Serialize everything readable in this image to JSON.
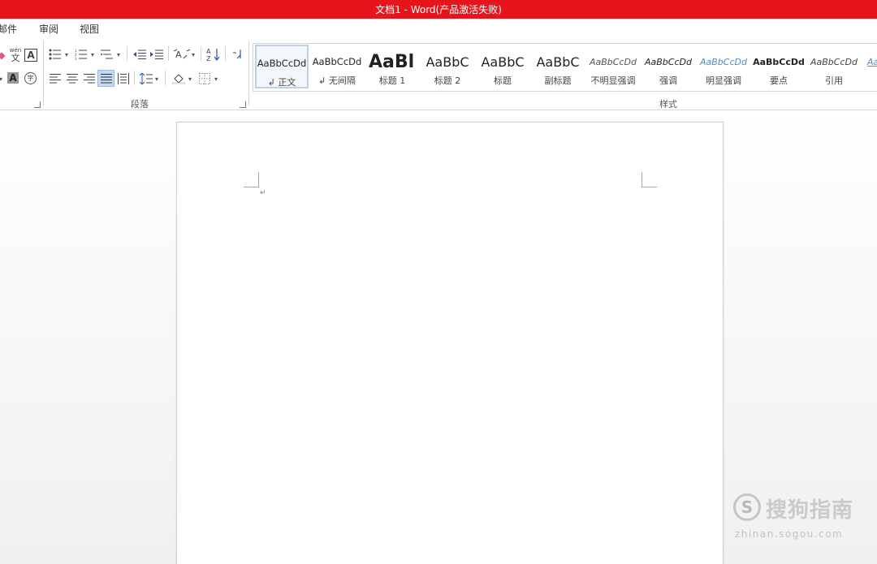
{
  "window": {
    "title": "文档1 -  Word(产品激活失败)"
  },
  "menu": {
    "tabs": [
      "邮件",
      "审阅",
      "视图"
    ]
  },
  "ribbon": {
    "groups": {
      "paragraph": "段落",
      "styles": "样式"
    },
    "font_partial": {
      "phonetic_glyph_top": "wén",
      "phonetic_glyph_bottom": "文",
      "char_border_glyph": "A",
      "shade_glyph": "A",
      "circle_char_glyph": "字"
    },
    "styles": [
      {
        "preview": "AaBbCcDd",
        "name": "↲ 正文",
        "selected": true
      },
      {
        "preview": "AaBbCcDd",
        "name": "↲ 无间隔"
      },
      {
        "preview": "AaBl",
        "name": "标题 1"
      },
      {
        "preview": "AaBbC",
        "name": "标题 2"
      },
      {
        "preview": "AaBbC",
        "name": "标题"
      },
      {
        "preview": "AaBbC",
        "name": "副标题"
      },
      {
        "preview": "AaBbCcDd",
        "name": "不明显强调"
      },
      {
        "preview": "AaBbCcDd",
        "name": "强调"
      },
      {
        "preview": "AaBbCcDd",
        "name": "明显强调"
      },
      {
        "preview": "AaBbCcDd",
        "name": "要点"
      },
      {
        "preview": "AaBbCcDd",
        "name": "引用"
      },
      {
        "preview": "AaBbCcDd",
        "name": "明"
      }
    ]
  },
  "document": {
    "paragraph_mark": "↵"
  },
  "watermark": {
    "logo_glyph": "S",
    "text": "搜狗指南",
    "url": "zhinan.sogou.com"
  },
  "colors": {
    "title_bar": "#e8141b",
    "accent_blue": "#2b579a",
    "selected_style": "#bcd0e8"
  },
  "icons": {
    "font_partial": [
      "eraser-icon",
      "phonetic-guide-icon",
      "char-border-icon",
      "text-shading-icon",
      "enclose-char-icon"
    ],
    "paragraph": [
      "bullets-icon",
      "numbering-icon",
      "multilevel-list-icon",
      "decrease-indent-icon",
      "increase-indent-icon",
      "chinese-layout-icon",
      "sort-icon",
      "show-marks-icon",
      "align-left-icon",
      "align-center-icon",
      "align-right-icon",
      "justify-icon",
      "distributed-icon",
      "line-spacing-icon",
      "shading-icon",
      "borders-icon"
    ]
  }
}
